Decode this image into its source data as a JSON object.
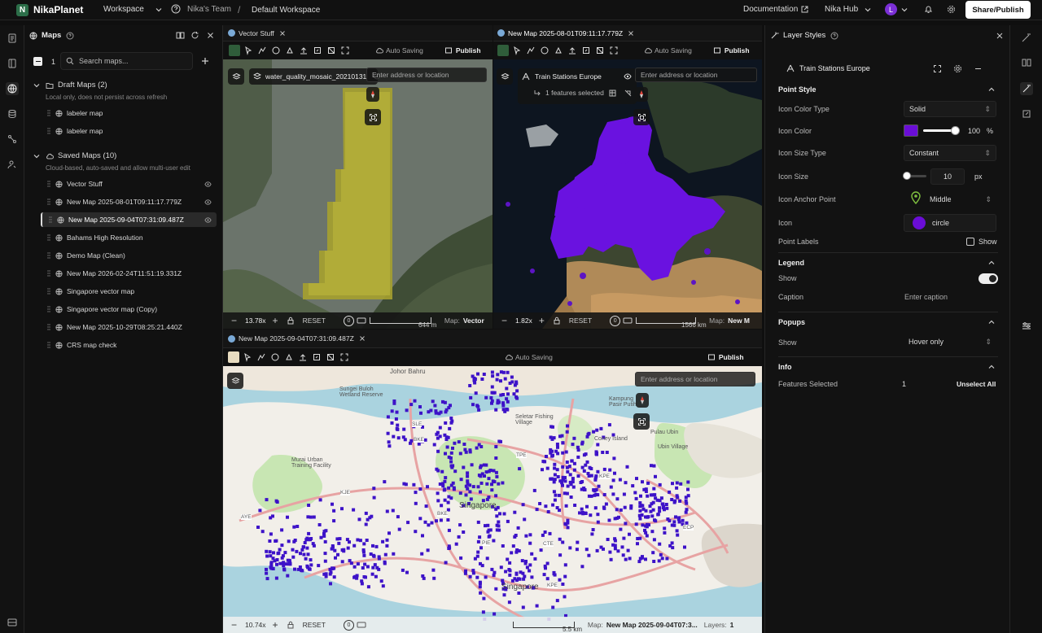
{
  "topbar": {
    "logo_letter": "N",
    "app_name": "NikaPlanet",
    "workspace_label": "Workspace",
    "team_label": "Nika's Team",
    "breadcrumb_sep": "/",
    "workspace_name": "Default Workspace",
    "documentation_label": "Documentation",
    "hub_label": "Nika Hub",
    "avatar_letter": "L",
    "share_label": "Share/Publish"
  },
  "sidebar": {
    "title": "Maps",
    "count": "1",
    "search_placeholder": "Search maps...",
    "draft_header": "Draft Maps (2)",
    "draft_sub": "Local only, does not persist across refresh",
    "draft_items": [
      "labeler map",
      "labeler map"
    ],
    "saved_header": "Saved Maps (10)",
    "saved_sub": "Cloud-based, auto-saved and allow multi-user edit",
    "saved_items": [
      "Vector Stuff",
      "New Map 2025-08-01T09:11:17.779Z",
      "New Map 2025-09-04T07:31:09.487Z",
      "Bahams High Resolution",
      "Demo Map (Clean)",
      "New Map 2026-02-24T11:51:19.331Z",
      "Singapore vector map",
      "Singapore vector map (Copy)",
      "New Map 2025-10-29T08:25:21.440Z",
      "CRS map check"
    ]
  },
  "pane1": {
    "tab": "Vector Stuff",
    "auto_saving": "Auto Saving",
    "publish": "Publish",
    "layer_name": "water_quality_mosaic_20210131",
    "address_placeholder": "Enter address or location",
    "zoom": "13.78x",
    "reset": "RESET",
    "zero": "0",
    "scale": "644 m",
    "map_label": "Map:",
    "map_name": "Vector"
  },
  "pane2": {
    "tab": "New Map 2025-08-01T09:11:17.779Z",
    "auto_saving": "Auto Saving",
    "publish": "Publish",
    "layer_name": "Train Stations Europe",
    "features_selected": "1 features selected",
    "address_placeholder": "Enter address or location",
    "zoom": "1.82x",
    "reset": "RESET",
    "zero": "0",
    "scale": "1566 km",
    "map_label": "Map:",
    "map_name": "New M"
  },
  "pane3": {
    "tab": "New Map 2025-09-04T07:31:09.487Z",
    "auto_saving": "Auto Saving",
    "publish": "Publish",
    "address_placeholder": "Enter address or location",
    "zoom": "10.74x",
    "reset": "RESET",
    "zero": "0",
    "scale": "5.5 km",
    "map_label": "Map:",
    "map_name": "New Map 2025-09-04T07:3...",
    "layers_label": "Layers:",
    "layers_count": "1",
    "places": {
      "johor": "Johor Bahru",
      "singapore": "Singapore",
      "singapore2": "Singapore",
      "coney": "Coney Island",
      "pulau": "Pulau Ubin",
      "ubin": "Ubin Village",
      "seletar": "Seletar Fishing Village",
      "kampung": "Kampung Pasir Putih",
      "wetland": "Sungei Buloh Wetland Reserve",
      "murai": "Murai Urban Training Facility",
      "sle": "SLE",
      "bke": "BKE",
      "tpe": "TPE",
      "kje": "KJE",
      "aye": "AYE",
      "pie": "PIE",
      "kpe": "KPE",
      "ecp": "ECP",
      "cte": "CTE",
      "kpe2": "KPE",
      "bke2": "BKE"
    }
  },
  "panel": {
    "title": "Layer Styles",
    "layer_name": "Train Stations Europe",
    "point_style": "Point Style",
    "icon_color_type_label": "Icon Color Type",
    "icon_color_type": "Solid",
    "icon_color_label": "Icon Color",
    "icon_color": "#6a0dd6",
    "opacity": "100",
    "opacity_unit": "%",
    "icon_size_type_label": "Icon Size Type",
    "icon_size_type": "Constant",
    "icon_size_label": "Icon Size",
    "icon_size": "10",
    "icon_size_unit": "px",
    "anchor_label": "Icon Anchor Point",
    "anchor": "Middle",
    "icon_label": "Icon",
    "icon": "circle",
    "point_labels_label": "Point Labels",
    "point_labels_show": "Show",
    "legend": "Legend",
    "legend_show_label": "Show",
    "caption_label": "Caption",
    "caption_placeholder": "Enter caption",
    "popups": "Popups",
    "popups_show_label": "Show",
    "popups_value": "Hover only",
    "info": "Info",
    "features_selected_label": "Features Selected",
    "features_selected_count": "1",
    "unselect_all": "Unselect All"
  },
  "colors": {
    "accent_purple": "#5b1fd8",
    "brand_green": "#2c6e49",
    "avatar": "#7b2fd6"
  }
}
